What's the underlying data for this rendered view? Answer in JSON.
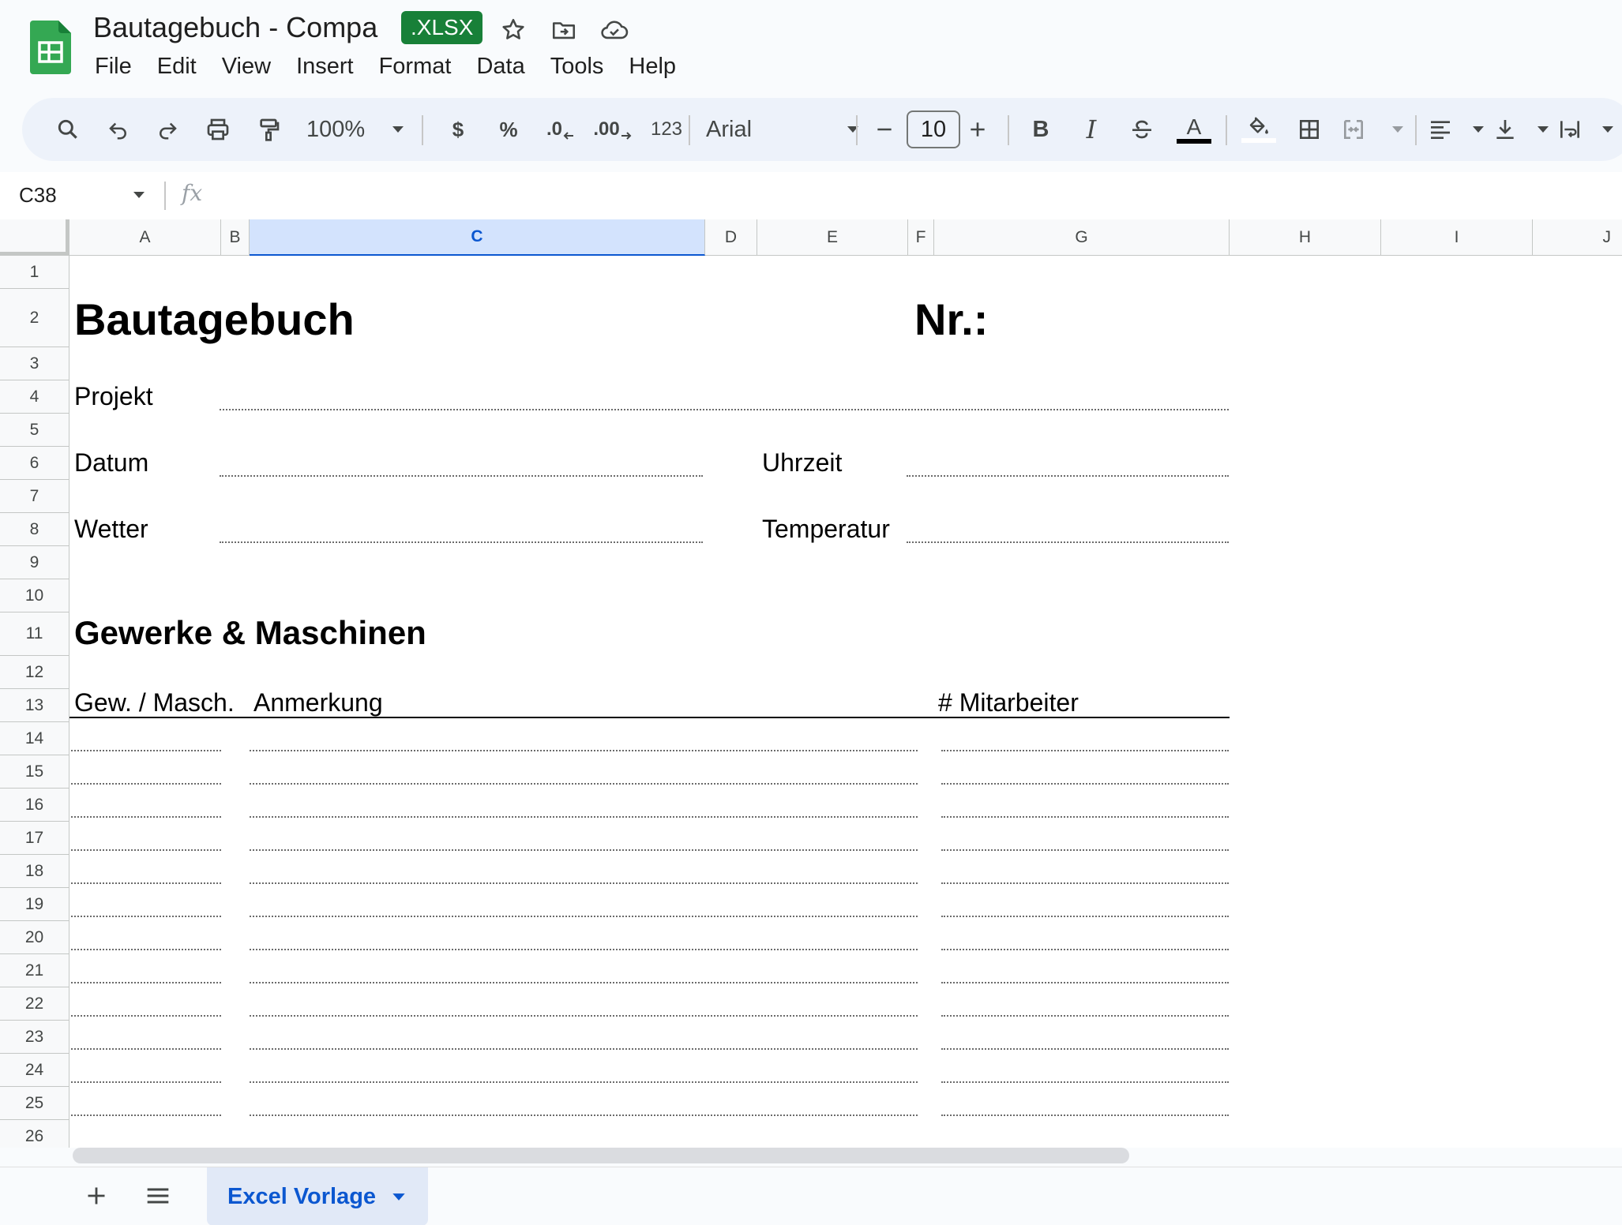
{
  "document": {
    "title": "Bautagebuch - Compa",
    "badge": ".XLSX"
  },
  "menu": [
    "File",
    "Edit",
    "View",
    "Insert",
    "Format",
    "Data",
    "Tools",
    "Help"
  ],
  "toolbar": {
    "zoom": "100%",
    "currency": "$",
    "percent": "%",
    "decrease_decimal": ".0",
    "increase_decimal": ".00",
    "number_format": "123",
    "font": "Arial",
    "font_size": "10",
    "bold": "B",
    "italic": "I",
    "text_color_letter": "A"
  },
  "formula_bar": {
    "name_box": "C38",
    "fx": "fx",
    "formula": ""
  },
  "columns": [
    "A",
    "B",
    "C",
    "D",
    "E",
    "F",
    "G",
    "H",
    "I",
    "J"
  ],
  "selected_column": "C",
  "rows": [
    "1",
    "2",
    "3",
    "4",
    "5",
    "6",
    "7",
    "8",
    "9",
    "10",
    "11",
    "12",
    "13",
    "14",
    "15",
    "16",
    "17",
    "18",
    "19",
    "20",
    "21",
    "22",
    "23",
    "24",
    "25",
    "26"
  ],
  "sheet": {
    "heading": "Bautagebuch",
    "number_label": "Nr.:",
    "project_label": "Projekt",
    "date_label": "Datum",
    "time_label": "Uhrzeit",
    "weather_label": "Wetter",
    "temperature_label": "Temperatur",
    "section_title": "Gewerke & Maschinen",
    "table_headers": {
      "trade": "Gew. / Masch.",
      "note": "Anmerkung",
      "workers": "# Mitarbeiter"
    }
  },
  "tabs": {
    "active": "Excel Vorlage"
  },
  "colors": {
    "accent": "#0b57d0",
    "badge": "#188038",
    "logo": "#34a853"
  }
}
